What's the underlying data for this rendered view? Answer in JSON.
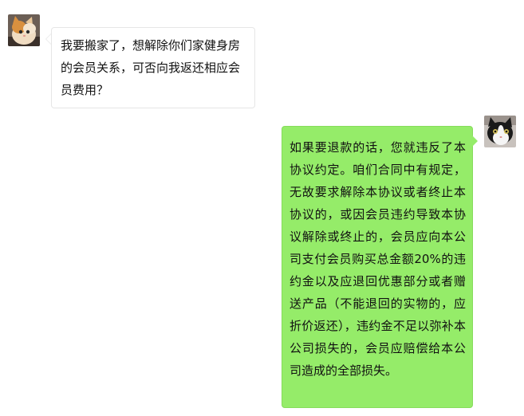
{
  "chat": {
    "messages": [
      {
        "sender": "other",
        "avatar": "cat-avatar-orange",
        "text": "我要搬家了，想解除你们家健身房的会员关系，可否向我返还相应会员费用？"
      },
      {
        "sender": "self",
        "avatar": "cat-avatar-black-white",
        "text": "如果要退款的话，您就违反了本协议约定。咱们合同中有规定，无故要求解除本协议或者终止本协议的，或因会员违约导致本协议解除或终止的，会员应向本公司支付会员购买总金额20%的违约金以及应退回优惠部分或者赠送产品（不能退回的实物的，应折价返还），违约金不足以弥补本公司损失的，会员应赔偿给本公司造成的全部损失。"
      }
    ]
  },
  "colors": {
    "self_bubble": "#95ec69",
    "other_bubble": "#ffffff",
    "other_border": "#e6e6e6"
  }
}
